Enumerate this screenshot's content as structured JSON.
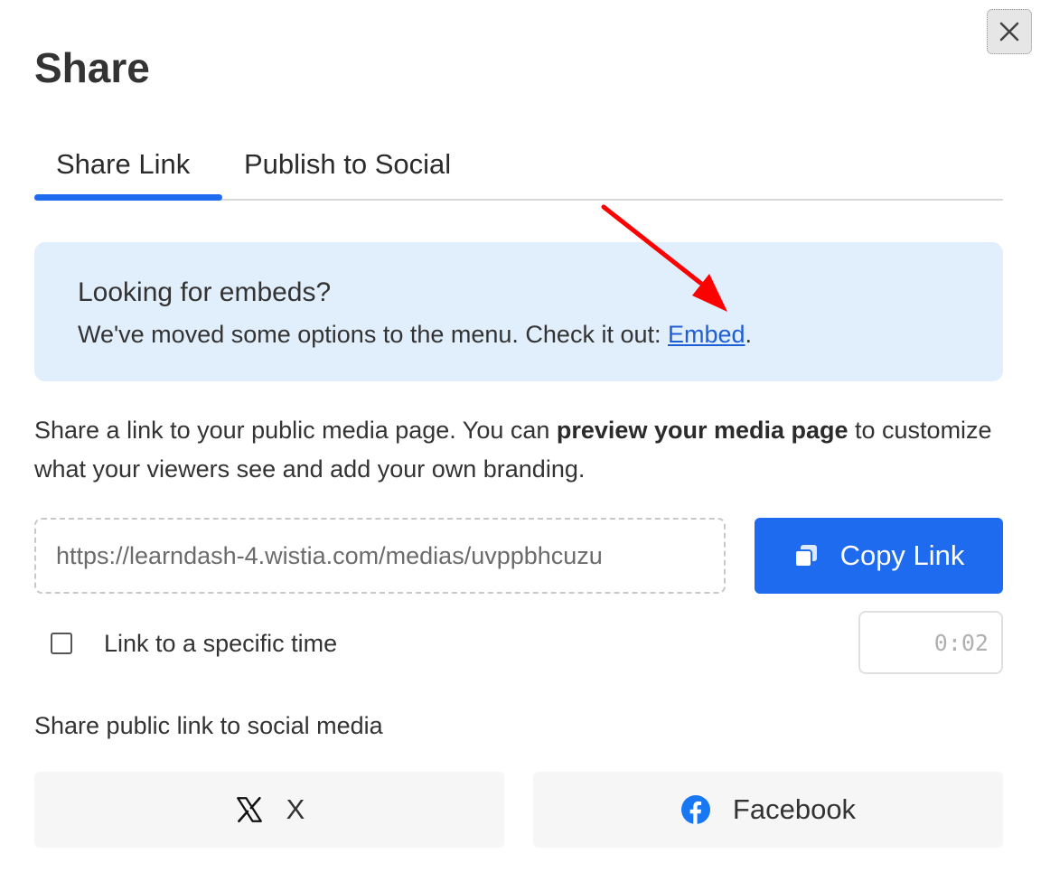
{
  "dialog": {
    "title": "Share",
    "close_icon": "close-icon"
  },
  "tabs": [
    {
      "label": "Share Link",
      "active": true
    },
    {
      "label": "Publish to Social",
      "active": false
    }
  ],
  "notice": {
    "title": "Looking for embeds?",
    "body_prefix": "We've moved some options to the menu. Check it out: ",
    "link_text": "Embed",
    "body_suffix": "."
  },
  "description": {
    "part1": "Share a link to your public media page. You can ",
    "bold": "preview your media page",
    "part2": " to customize what your viewers see and add your own branding."
  },
  "share_link": {
    "url": "https://learndash-4.wistia.com/medias/uvppbhcuzu",
    "copy_label": "Copy Link",
    "copy_icon": "copy-icon"
  },
  "specific_time": {
    "label": "Link to a specific time",
    "checked": false,
    "time_value": "0:02"
  },
  "social": {
    "heading": "Share public link to social media",
    "buttons": [
      {
        "label": "X",
        "icon": "x-logo-icon"
      },
      {
        "label": "Facebook",
        "icon": "facebook-icon"
      }
    ]
  },
  "colors": {
    "accent": "#1f6bf0",
    "notice_bg": "#e1eefc",
    "link": "#1f5fd6",
    "annotation_arrow": "#ff0000"
  }
}
